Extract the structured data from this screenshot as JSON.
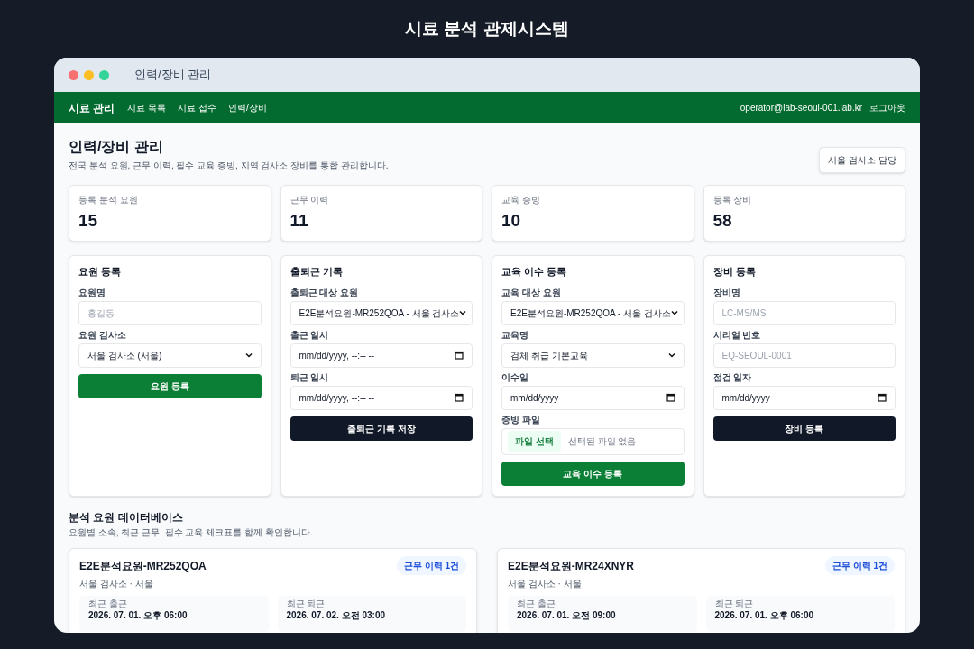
{
  "app_title": "시료 분석 관제시스템",
  "window": {
    "title": "인력/장비 관리"
  },
  "nav": {
    "brand": "시료 관리",
    "links": [
      {
        "label": "시료 목록"
      },
      {
        "label": "시료 접수"
      },
      {
        "label": "인력/장비"
      }
    ],
    "user": "operator@lab-seoul-001.lab.kr",
    "logout": "로그아웃"
  },
  "page": {
    "title": "인력/장비 관리",
    "subtitle": "전국 분석 요원, 근무 이력, 필수 교육 증빙, 지역 검사소 장비를 통합 관리합니다.",
    "badge": "서울 검사소 담당"
  },
  "stats": [
    {
      "label": "등록 분석 요원",
      "value": "15"
    },
    {
      "label": "근무 이력",
      "value": "11"
    },
    {
      "label": "교육 증빙",
      "value": "10"
    },
    {
      "label": "등록 장비",
      "value": "58"
    }
  ],
  "forms": [
    {
      "title": "요원 등록",
      "fields": [
        {
          "kind": "text",
          "label": "요원명",
          "placeholder": "홍길동"
        },
        {
          "kind": "select",
          "label": "요원 검사소",
          "value": "서울 검사소 (서울)"
        }
      ],
      "submit": {
        "label": "요원 등록"
      }
    },
    {
      "title": "출퇴근 기록",
      "fields": [
        {
          "kind": "select",
          "label": "출퇴근 대상 요원",
          "value": "E2E분석요원-MR252QOA - 서울 검사소"
        },
        {
          "kind": "date",
          "label": "출근 일시",
          "placeholder": "mm/dd/yyyy, --:-- --"
        },
        {
          "kind": "date",
          "label": "퇴근 일시",
          "placeholder": "mm/dd/yyyy, --:-- --"
        }
      ],
      "submit": {
        "label": "출퇴근 기록 저장"
      }
    },
    {
      "title": "교육 이수 등록",
      "fields": [
        {
          "kind": "select",
          "label": "교육 대상 요원",
          "value": "E2E분석요원-MR252QOA - 서울 검사소"
        },
        {
          "kind": "select",
          "label": "교육명",
          "value": "검체 취급 기본교육"
        },
        {
          "kind": "date",
          "label": "이수일",
          "placeholder": "mm/dd/yyyy"
        },
        {
          "kind": "file",
          "label": "증빙 파일",
          "button": "파일 선택",
          "value": "선택된 파일 없음"
        }
      ],
      "submit": {
        "label": "교육 이수 등록"
      }
    },
    {
      "title": "장비 등록",
      "fields": [
        {
          "kind": "text",
          "label": "장비명",
          "placeholder": "LC-MS/MS"
        },
        {
          "kind": "text",
          "label": "시리얼 번호",
          "placeholder": "EQ-SEOUL-0001"
        },
        {
          "kind": "date",
          "label": "점검 일자",
          "placeholder": "mm/dd/yyyy"
        }
      ],
      "submit": {
        "label": "장비 등록"
      }
    }
  ],
  "database": {
    "title": "분석 요원 데이터베이스",
    "subtitle": "요원별 소속, 최근 근무, 필수 교육 체크표를 함께 확인합니다.",
    "staff": [
      {
        "name": "E2E분석요원-MR252QOA",
        "location": "서울 검사소 · 서울",
        "badge": "근무 이력 1건",
        "records": [
          {
            "label": "최근 출근",
            "value": "2026. 07. 01. 오후 06:00"
          },
          {
            "label": "최근 퇴근",
            "value": "2026. 07. 02. 오전 03:00"
          }
        ]
      },
      {
        "name": "E2E분석요원-MR24XNYR",
        "location": "서울 검사소 · 서울",
        "badge": "근무 이력 1건",
        "records": [
          {
            "label": "최근 출근",
            "value": "2026. 07. 01. 오전 09:00"
          },
          {
            "label": "최근 퇴근",
            "value": "2026. 07. 01. 오후 06:00"
          }
        ]
      }
    ]
  }
}
